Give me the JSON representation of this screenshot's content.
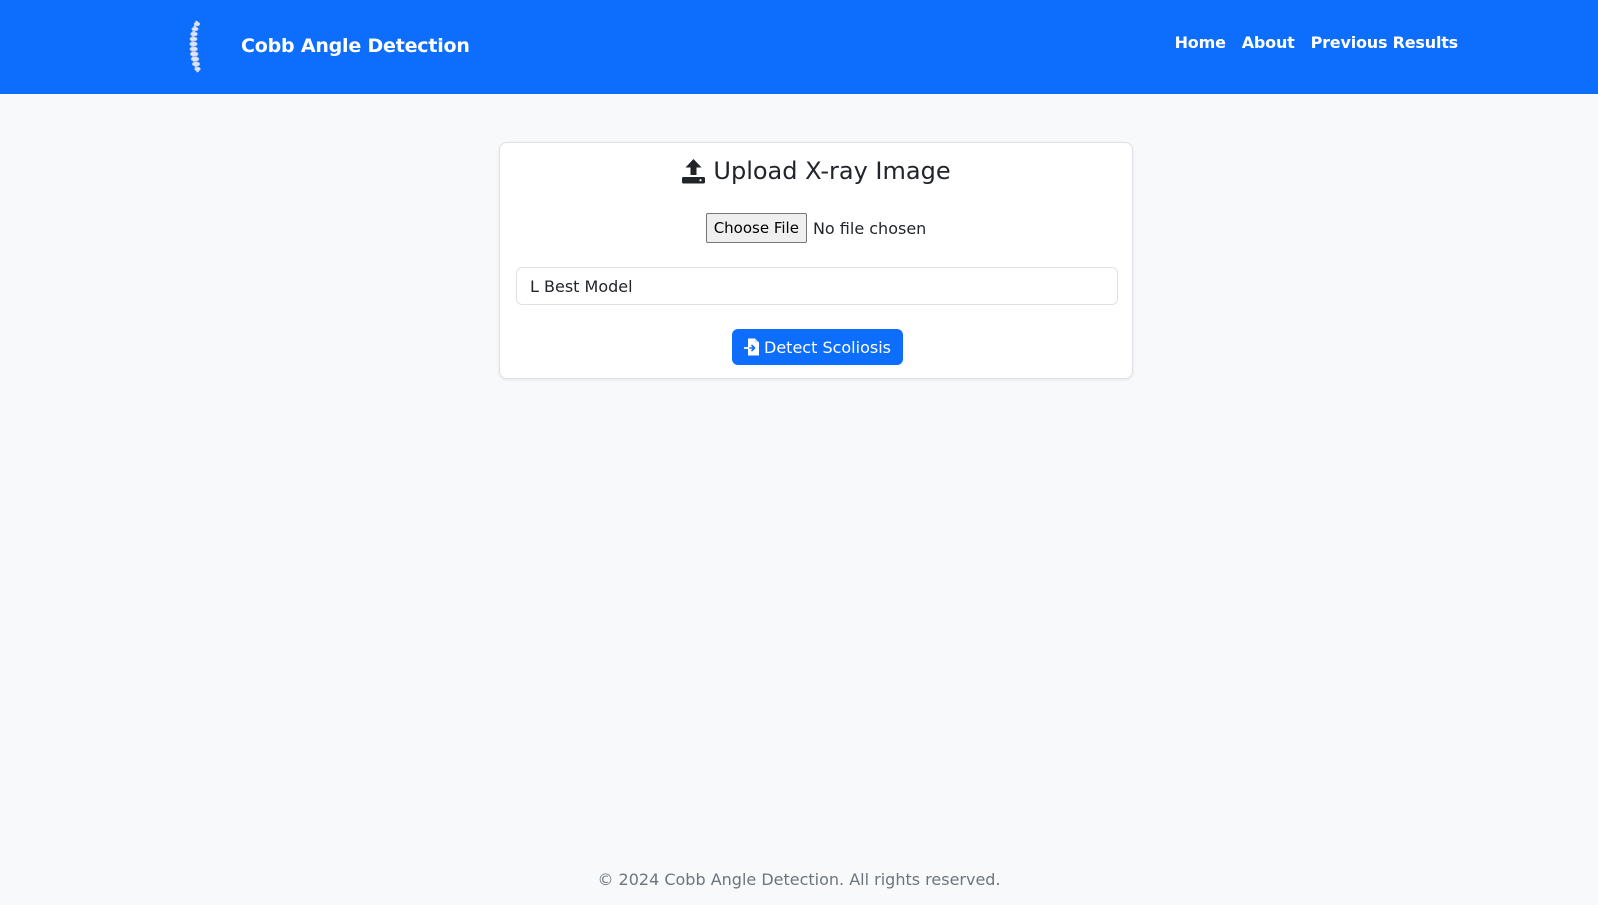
{
  "navbar": {
    "logo_icon": "spine-icon",
    "brand": "Cobb Angle Detection",
    "links": [
      "Home",
      "About",
      "Previous Results"
    ],
    "background": "#0d6efd"
  },
  "upload_card": {
    "title": "Upload X-ray Image",
    "title_icon": "upload-icon",
    "file_button": "Choose File",
    "file_status": "No file chosen",
    "model_select_value": "L Best Model",
    "detect_button": "Detect Scoliosis",
    "detect_icon": "file-import-icon",
    "accent": "#0d6efd"
  },
  "footer": {
    "text": "© 2024 Cobb Angle Detection. All rights reserved."
  }
}
